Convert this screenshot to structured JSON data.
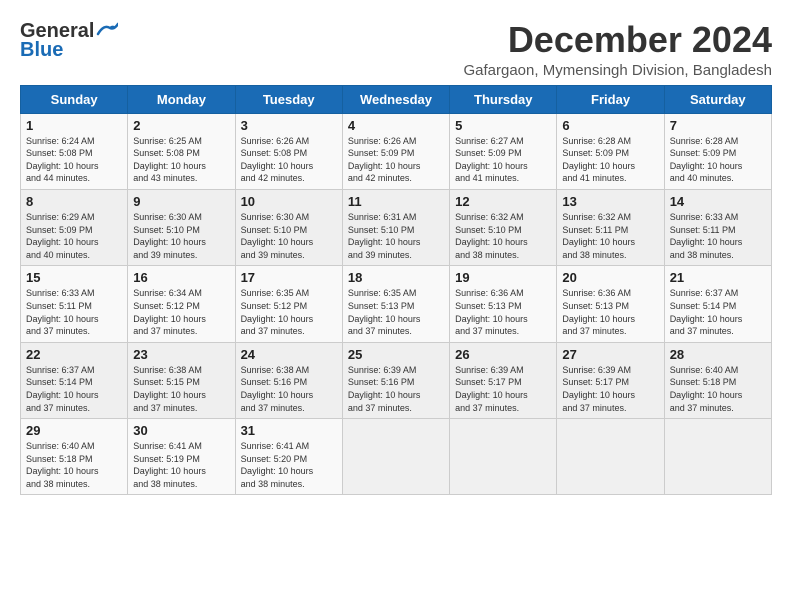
{
  "logo": {
    "general": "General",
    "blue": "Blue",
    "tagline": ""
  },
  "title": "December 2024",
  "subtitle": "Gafargaon, Mymensingh Division, Bangladesh",
  "weekdays": [
    "Sunday",
    "Monday",
    "Tuesday",
    "Wednesday",
    "Thursday",
    "Friday",
    "Saturday"
  ],
  "weeks": [
    [
      {
        "day": "1",
        "info": "Sunrise: 6:24 AM\nSunset: 5:08 PM\nDaylight: 10 hours\nand 44 minutes."
      },
      {
        "day": "2",
        "info": "Sunrise: 6:25 AM\nSunset: 5:08 PM\nDaylight: 10 hours\nand 43 minutes."
      },
      {
        "day": "3",
        "info": "Sunrise: 6:26 AM\nSunset: 5:08 PM\nDaylight: 10 hours\nand 42 minutes."
      },
      {
        "day": "4",
        "info": "Sunrise: 6:26 AM\nSunset: 5:09 PM\nDaylight: 10 hours\nand 42 minutes."
      },
      {
        "day": "5",
        "info": "Sunrise: 6:27 AM\nSunset: 5:09 PM\nDaylight: 10 hours\nand 41 minutes."
      },
      {
        "day": "6",
        "info": "Sunrise: 6:28 AM\nSunset: 5:09 PM\nDaylight: 10 hours\nand 41 minutes."
      },
      {
        "day": "7",
        "info": "Sunrise: 6:28 AM\nSunset: 5:09 PM\nDaylight: 10 hours\nand 40 minutes."
      }
    ],
    [
      {
        "day": "8",
        "info": "Sunrise: 6:29 AM\nSunset: 5:09 PM\nDaylight: 10 hours\nand 40 minutes."
      },
      {
        "day": "9",
        "info": "Sunrise: 6:30 AM\nSunset: 5:10 PM\nDaylight: 10 hours\nand 39 minutes."
      },
      {
        "day": "10",
        "info": "Sunrise: 6:30 AM\nSunset: 5:10 PM\nDaylight: 10 hours\nand 39 minutes."
      },
      {
        "day": "11",
        "info": "Sunrise: 6:31 AM\nSunset: 5:10 PM\nDaylight: 10 hours\nand 39 minutes."
      },
      {
        "day": "12",
        "info": "Sunrise: 6:32 AM\nSunset: 5:10 PM\nDaylight: 10 hours\nand 38 minutes."
      },
      {
        "day": "13",
        "info": "Sunrise: 6:32 AM\nSunset: 5:11 PM\nDaylight: 10 hours\nand 38 minutes."
      },
      {
        "day": "14",
        "info": "Sunrise: 6:33 AM\nSunset: 5:11 PM\nDaylight: 10 hours\nand 38 minutes."
      }
    ],
    [
      {
        "day": "15",
        "info": "Sunrise: 6:33 AM\nSunset: 5:11 PM\nDaylight: 10 hours\nand 37 minutes."
      },
      {
        "day": "16",
        "info": "Sunrise: 6:34 AM\nSunset: 5:12 PM\nDaylight: 10 hours\nand 37 minutes."
      },
      {
        "day": "17",
        "info": "Sunrise: 6:35 AM\nSunset: 5:12 PM\nDaylight: 10 hours\nand 37 minutes."
      },
      {
        "day": "18",
        "info": "Sunrise: 6:35 AM\nSunset: 5:13 PM\nDaylight: 10 hours\nand 37 minutes."
      },
      {
        "day": "19",
        "info": "Sunrise: 6:36 AM\nSunset: 5:13 PM\nDaylight: 10 hours\nand 37 minutes."
      },
      {
        "day": "20",
        "info": "Sunrise: 6:36 AM\nSunset: 5:13 PM\nDaylight: 10 hours\nand 37 minutes."
      },
      {
        "day": "21",
        "info": "Sunrise: 6:37 AM\nSunset: 5:14 PM\nDaylight: 10 hours\nand 37 minutes."
      }
    ],
    [
      {
        "day": "22",
        "info": "Sunrise: 6:37 AM\nSunset: 5:14 PM\nDaylight: 10 hours\nand 37 minutes."
      },
      {
        "day": "23",
        "info": "Sunrise: 6:38 AM\nSunset: 5:15 PM\nDaylight: 10 hours\nand 37 minutes."
      },
      {
        "day": "24",
        "info": "Sunrise: 6:38 AM\nSunset: 5:16 PM\nDaylight: 10 hours\nand 37 minutes."
      },
      {
        "day": "25",
        "info": "Sunrise: 6:39 AM\nSunset: 5:16 PM\nDaylight: 10 hours\nand 37 minutes."
      },
      {
        "day": "26",
        "info": "Sunrise: 6:39 AM\nSunset: 5:17 PM\nDaylight: 10 hours\nand 37 minutes."
      },
      {
        "day": "27",
        "info": "Sunrise: 6:39 AM\nSunset: 5:17 PM\nDaylight: 10 hours\nand 37 minutes."
      },
      {
        "day": "28",
        "info": "Sunrise: 6:40 AM\nSunset: 5:18 PM\nDaylight: 10 hours\nand 37 minutes."
      }
    ],
    [
      {
        "day": "29",
        "info": "Sunrise: 6:40 AM\nSunset: 5:18 PM\nDaylight: 10 hours\nand 38 minutes."
      },
      {
        "day": "30",
        "info": "Sunrise: 6:41 AM\nSunset: 5:19 PM\nDaylight: 10 hours\nand 38 minutes."
      },
      {
        "day": "31",
        "info": "Sunrise: 6:41 AM\nSunset: 5:20 PM\nDaylight: 10 hours\nand 38 minutes."
      },
      {
        "day": "",
        "info": ""
      },
      {
        "day": "",
        "info": ""
      },
      {
        "day": "",
        "info": ""
      },
      {
        "day": "",
        "info": ""
      }
    ]
  ]
}
